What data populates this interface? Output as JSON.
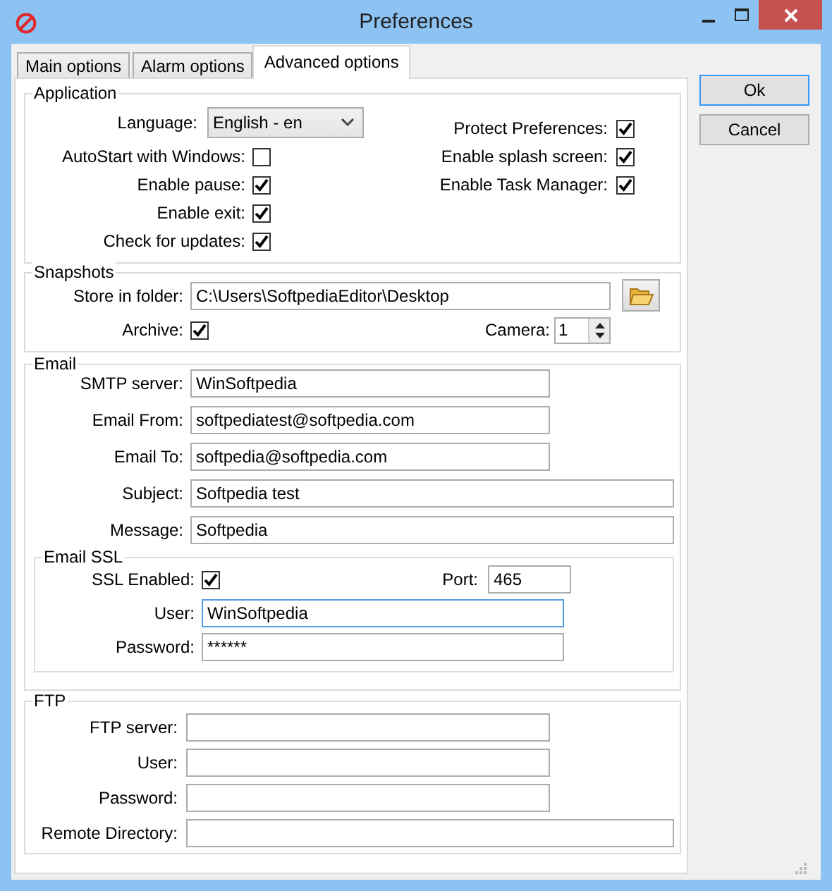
{
  "window": {
    "title": "Preferences"
  },
  "tabs": [
    {
      "label": "Main options",
      "selected": false
    },
    {
      "label": "Alarm options",
      "selected": false
    },
    {
      "label": "Advanced options",
      "selected": true
    }
  ],
  "buttons": [
    {
      "label": "Ok",
      "default": true
    },
    {
      "label": "Cancel",
      "default": false
    }
  ],
  "application": {
    "title": "Application",
    "language": {
      "label": "Language:",
      "value": "English - en"
    },
    "left_options": [
      {
        "label": "AutoStart with Windows:",
        "checked": false
      },
      {
        "label": "Enable pause:",
        "checked": true
      },
      {
        "label": "Enable exit:",
        "checked": true
      },
      {
        "label": "Check for updates:",
        "checked": true
      }
    ],
    "right_options": [
      {
        "label": "Protect Preferences:",
        "checked": true
      },
      {
        "label": "Enable splash screen:",
        "checked": true
      },
      {
        "label": "Enable Task Manager:",
        "checked": true
      }
    ]
  },
  "snapshots": {
    "title": "Snapshots",
    "folder": {
      "label": "Store in folder:",
      "value": "C:\\Users\\SoftpediaEditor\\Desktop"
    },
    "archive": {
      "label": "Archive:",
      "checked": true
    },
    "camera": {
      "label": "Camera:",
      "value": "1"
    }
  },
  "email": {
    "title": "Email",
    "fields": [
      {
        "label": "SMTP server:",
        "value": "WinSoftpedia"
      },
      {
        "label": "Email From:",
        "value": "softpediatest@softpedia.com"
      },
      {
        "label": "Email To:",
        "value": "softpedia@softpedia.com"
      },
      {
        "label": "Subject:",
        "value": "Softpedia test"
      },
      {
        "label": "Message:",
        "value": "Softpedia"
      }
    ],
    "ssl": {
      "title": "Email SSL",
      "enabled": {
        "label": "SSL Enabled:",
        "checked": true
      },
      "port": {
        "label": "Port:",
        "value": "465"
      },
      "fields": [
        {
          "label": "User:",
          "value": "WinSoftpedia",
          "focused": true
        },
        {
          "label": "Password:",
          "value": "******",
          "focused": false
        }
      ]
    }
  },
  "ftp": {
    "title": "FTP",
    "fields": [
      {
        "label": "FTP server:"
      },
      {
        "label": "User:"
      },
      {
        "label": "Password:"
      },
      {
        "label": "Remote Directory:"
      }
    ]
  }
}
